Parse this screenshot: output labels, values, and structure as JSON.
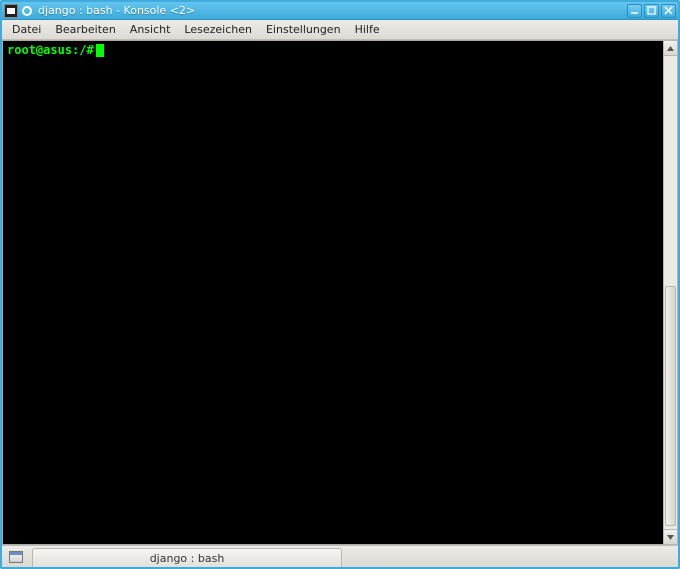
{
  "window": {
    "title": "django : bash - Konsole <2>"
  },
  "menu": {
    "items": [
      "Datei",
      "Bearbeiten",
      "Ansicht",
      "Lesezeichen",
      "Einstellungen",
      "Hilfe"
    ]
  },
  "terminal": {
    "prompt": "root@asus:/#"
  },
  "tabs": {
    "items": [
      {
        "label": "django : bash"
      }
    ]
  }
}
